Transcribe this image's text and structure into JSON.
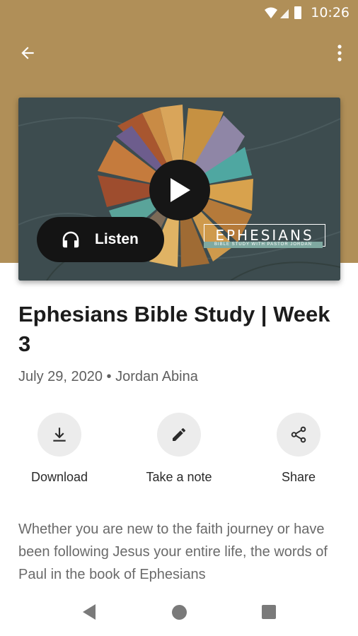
{
  "status_bar": {
    "time": "10:26"
  },
  "app_bar": {
    "back_icon": "arrow-left-icon",
    "more_icon": "more-vert-icon"
  },
  "media": {
    "series_title": "EPHESIANS",
    "series_subtitle": "BIBLE STUDY WITH PASTOR JORDAN",
    "listen_label": "Listen",
    "play_icon": "play-icon",
    "listen_icon": "headphones-icon"
  },
  "episode": {
    "title": "Ephesians Bible Study | Week 3",
    "meta": "July 29, 2020 • Jordan Abina"
  },
  "actions": [
    {
      "label": "Download",
      "icon": "download-icon"
    },
    {
      "label": "Take a note",
      "icon": "pencil-icon"
    },
    {
      "label": "Share",
      "icon": "share-icon"
    }
  ],
  "description": "Whether you are new to the faith journey or have been following Jesus your entire life, the words of Paul in the book of Ephesians",
  "colors": {
    "header_bg": "#b08f58",
    "action_bg": "#ececec",
    "pill_bg": "#141414"
  }
}
